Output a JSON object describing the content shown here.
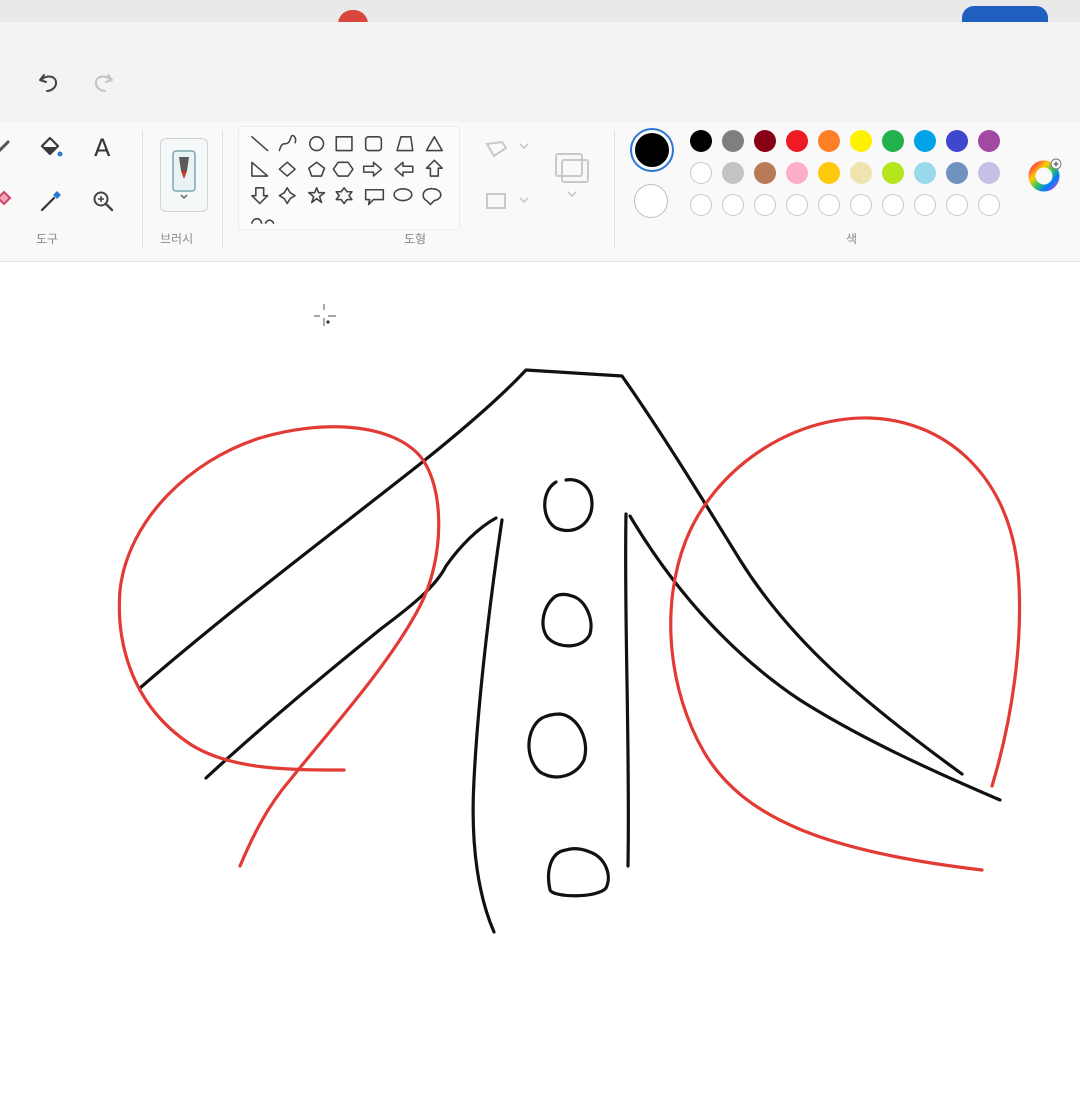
{
  "toolbar": {
    "tools_label": "도구",
    "brush_label": "브러시",
    "shapes_label": "도형",
    "colors_label": "색",
    "text_tool_glyph": "A"
  },
  "icons": {
    "undo": "undo-icon",
    "redo": "redo-icon",
    "pencil": "pencil-icon",
    "fill": "fill-bucket-icon",
    "text": "text-icon",
    "eraser": "eraser-icon",
    "picker": "color-picker-icon",
    "zoom": "magnifier-icon",
    "brush": "brush-icon",
    "selection": "selection-icon",
    "image": "image-icon",
    "layers": "layers-icon",
    "edit_colors": "color-wheel-icon"
  },
  "colors": {
    "color1": "#000000",
    "color2": "#ffffff",
    "palette_row1": [
      "#000000",
      "#7f7f7f",
      "#880015",
      "#ed1c24",
      "#ff7f27",
      "#fff200",
      "#22b14c",
      "#00a2e8",
      "#3f48cc",
      "#a349a4"
    ],
    "palette_row2": [
      "#ffffff",
      "#c3c3c3",
      "#b97a57",
      "#ffaec9",
      "#ffc90e",
      "#efe4b0",
      "#b5e61d",
      "#99d9ea",
      "#7092be",
      "#c8bfe7"
    ],
    "palette_row3_empty": 10,
    "ink_black": "#111111",
    "ink_red": "#e23a34"
  }
}
